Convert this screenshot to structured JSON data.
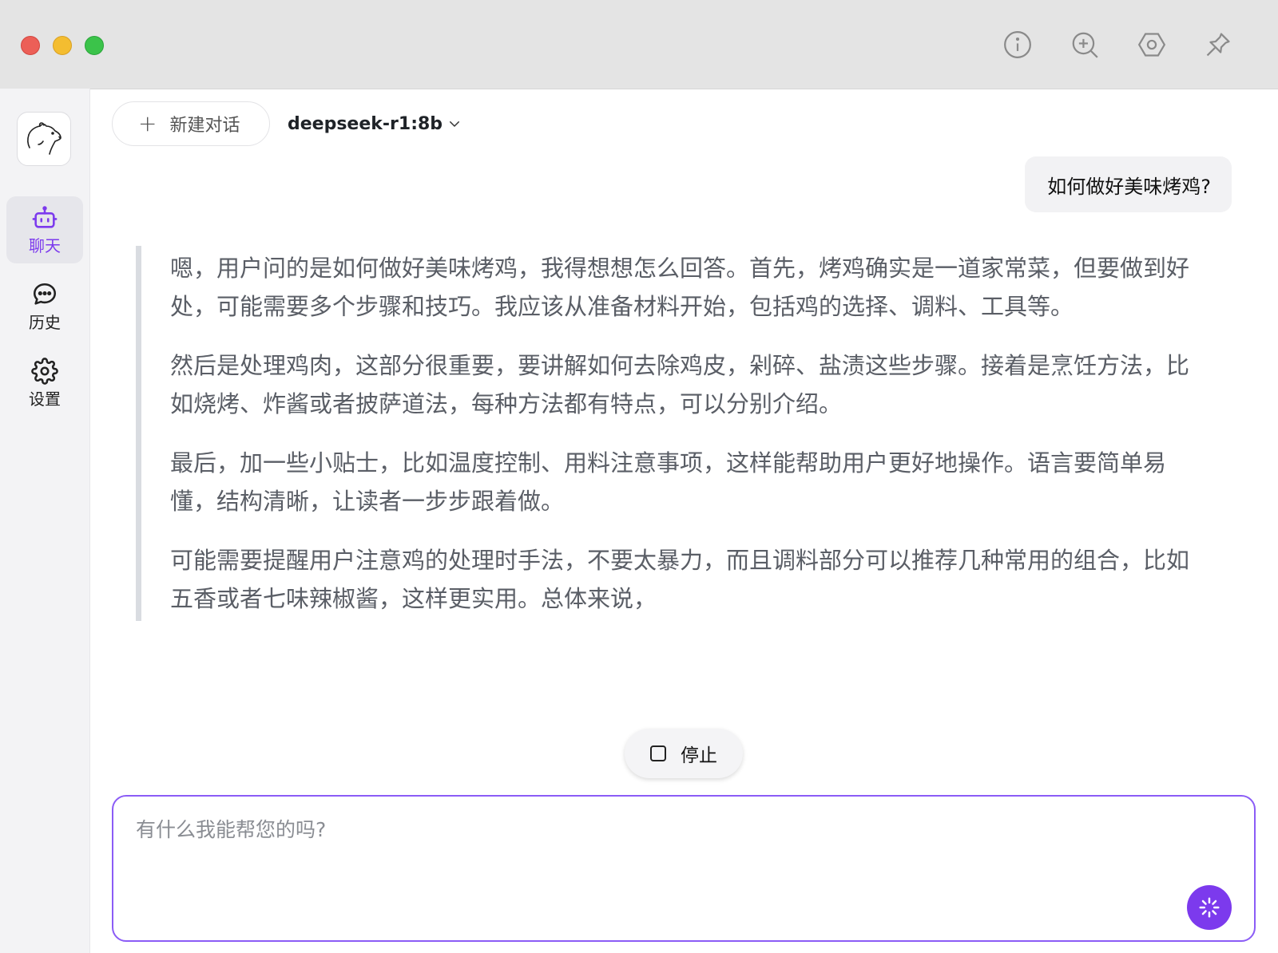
{
  "titlebar": {
    "icons": [
      "info-icon",
      "zoom-in-icon",
      "hexagon-settings-icon",
      "pin-icon"
    ]
  },
  "sidebar": {
    "logo_icon": "bear-logo-icon",
    "items": [
      {
        "label": "聊天",
        "icon": "robot-icon",
        "active": true
      },
      {
        "label": "历史",
        "icon": "chat-bubble-icon",
        "active": false
      },
      {
        "label": "设置",
        "icon": "gear-icon",
        "active": false
      }
    ]
  },
  "toolbar": {
    "new_chat_label": "新建对话",
    "model_label": "deepseek-r1:8b"
  },
  "conversation": {
    "user_message": "如何做好美味烤鸡?",
    "reasoning": [
      "嗯，用户问的是如何做好美味烤鸡，我得想想怎么回答。首先，烤鸡确实是一道家常菜，但要做到好处，可能需要多个步骤和技巧。我应该从准备材料开始，包括鸡的选择、调料、工具等。",
      "然后是处理鸡肉，这部分很重要，要讲解如何去除鸡皮，剁碎、盐渍这些步骤。接着是烹饪方法，比如烧烤、炸酱或者披萨道法，每种方法都有特点，可以分别介绍。",
      "最后，加一些小贴士，比如温度控制、用料注意事项，这样能帮助用户更好地操作。语言要简单易懂，结构清晰，让读者一步步跟着做。",
      "可能需要提醒用户注意鸡的处理时手法，不要太暴力，而且调料部分可以推荐几种常用的组合，比如五香或者七味辣椒酱，这样更实用。总体来说，"
    ]
  },
  "controls": {
    "stop_label": "停止"
  },
  "input": {
    "placeholder": "有什么我能帮您的吗?",
    "value": ""
  },
  "colors": {
    "accent": "#7c3aed",
    "input_border": "#8b5cf6",
    "titlebar": "#e4e4e4",
    "sidebar": "#f3f3f5"
  }
}
